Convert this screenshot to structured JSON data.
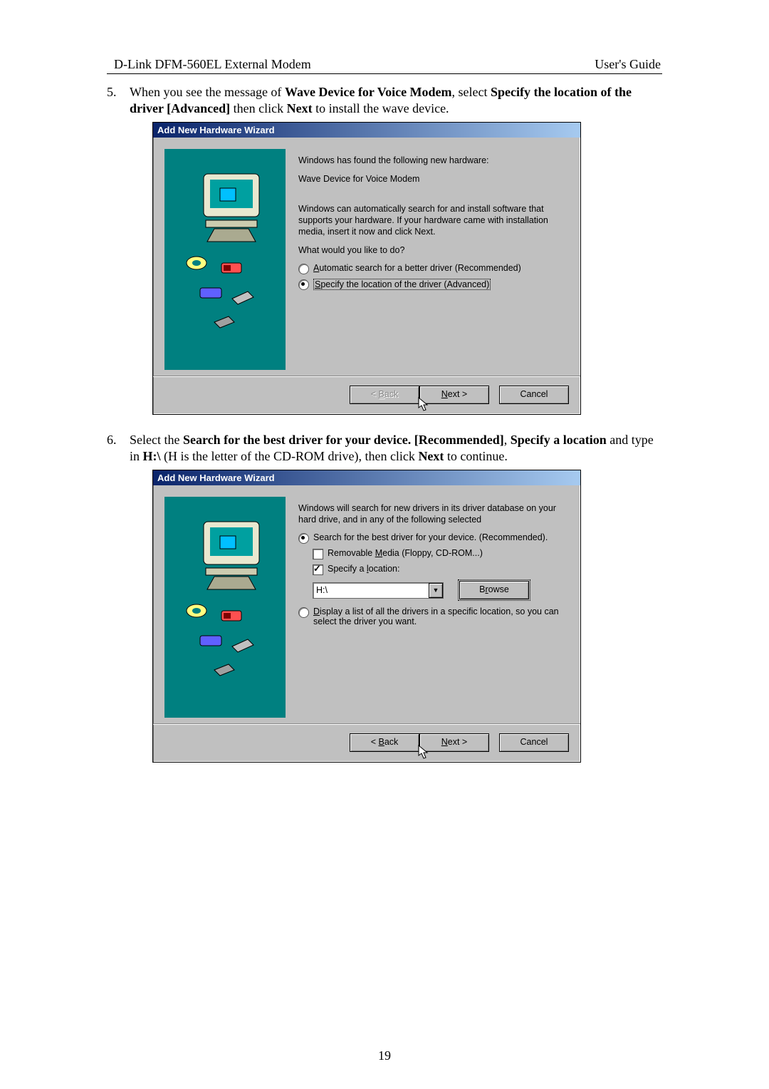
{
  "header": {
    "left": "D-Link DFM-560EL External Modem",
    "right": "User's Guide"
  },
  "steps": {
    "s5": {
      "num": "5.",
      "p1a": "When you see the message of ",
      "p1b": "Wave Device for Voice Modem",
      "p1c": ", select ",
      "p1d": "Specify the location of the driver [Advanced]",
      "p1e": " then click ",
      "p1f": "Next",
      "p1g": " to install the wave device."
    },
    "s6": {
      "num": "6.",
      "p1a": "Select the ",
      "p1b": "Search for the best driver for your device. [Recommended]",
      "p1c": ", ",
      "p1d": "Specify a location",
      "p1e": " and type in ",
      "p1f": "H:\\",
      "p1g": " (H is the letter of the CD-ROM drive), then click ",
      "p1h": "Next",
      "p1i": " to continue."
    }
  },
  "wiz1": {
    "title": "Add New Hardware Wizard",
    "found": "Windows has found the following new hardware:",
    "device": "Wave Device for Voice Modem",
    "auto": "Windows can automatically search for and install software that supports your hardware. If your hardware came with installation media, insert it now and click Next.",
    "what": "What would you like to do?",
    "opt1_a": "A",
    "opt1_b": "utomatic search for a better driver (Recommended)",
    "opt2_a": "S",
    "opt2_b": "pecify the location of the driver (Advanced)",
    "back_u": "B",
    "back": "ack",
    "back_prefix": "< ",
    "next": "Next >",
    "next_u": "N",
    "next_rest": "ext >",
    "cancel": "Cancel"
  },
  "wiz2": {
    "title": "Add New Hardware Wizard",
    "intro": "Windows will search for new drivers in its driver database on your hard drive, and in any of the following selected",
    "opt1": "Search for the best driver for your device. (Recommended).",
    "chk1_a": "Removable ",
    "chk1_u": "M",
    "chk1_b": "edia (Floppy, CD-ROM...)",
    "chk2_a": "Specify a ",
    "chk2_u": "l",
    "chk2_b": "ocation:",
    "path": "H:\\",
    "browse_u": "r",
    "browse_a": "B",
    "browse_b": "owse",
    "opt2_u": "D",
    "opt2": "isplay a list of all the drivers in a specific location, so you can select the driver you want.",
    "back_prefix": "< ",
    "back_u": "B",
    "back": "ack",
    "next_u": "N",
    "next_rest": "ext >",
    "cancel": "Cancel"
  },
  "page_num": "19"
}
